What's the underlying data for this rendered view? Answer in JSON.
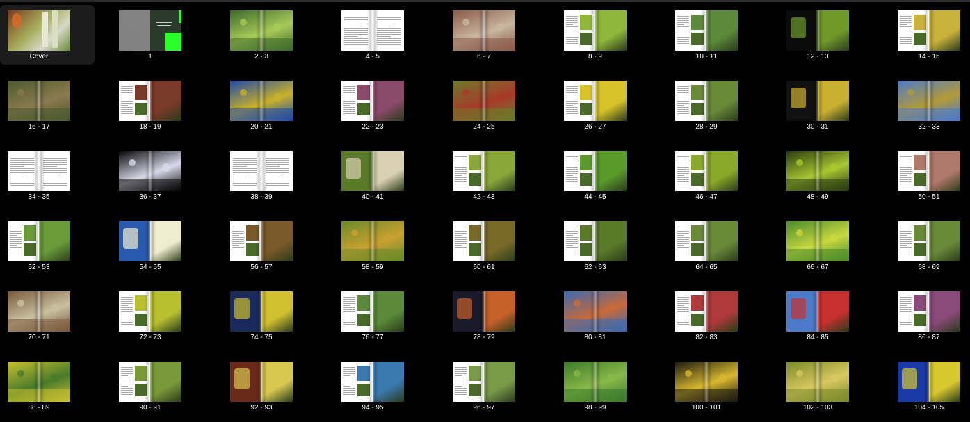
{
  "thumbnails": [
    {
      "label": "Cover",
      "style": "cover"
    },
    {
      "label": "1",
      "style": "title"
    },
    {
      "label": "2 - 3",
      "style": "photo",
      "colors": [
        "#3f6b2a",
        "#a7c95a"
      ]
    },
    {
      "label": "4 - 5",
      "style": "text"
    },
    {
      "label": "6 - 7",
      "style": "photo",
      "colors": [
        "#8a5a4a",
        "#c8b6a0"
      ]
    },
    {
      "label": "8 - 9",
      "style": "mixed",
      "colors": [
        "#ffffff",
        "#8fb83a"
      ]
    },
    {
      "label": "10 - 11",
      "style": "mixed",
      "colors": [
        "#ffffff",
        "#5d8a3a"
      ]
    },
    {
      "label": "12 - 13",
      "style": "mixed",
      "colors": [
        "#0b0b0b",
        "#6f9a2a"
      ]
    },
    {
      "label": "14 - 15",
      "style": "mixed",
      "colors": [
        "#ffffff",
        "#c9b23a"
      ]
    },
    {
      "label": "16 - 17",
      "style": "photo",
      "colors": [
        "#4b5a2e",
        "#8a7a4e"
      ]
    },
    {
      "label": "18 - 19",
      "style": "mixed",
      "colors": [
        "#ffffff",
        "#7a3a2a"
      ]
    },
    {
      "label": "20 - 21",
      "style": "photo",
      "colors": [
        "#1f4aa8",
        "#c7b12a"
      ]
    },
    {
      "label": "22 - 23",
      "style": "mixed",
      "colors": [
        "#ffffff",
        "#8a4a6a"
      ]
    },
    {
      "label": "24 - 25",
      "style": "photo",
      "colors": [
        "#6b7a2a",
        "#a83a2a"
      ]
    },
    {
      "label": "26 - 27",
      "style": "mixed",
      "colors": [
        "#ffffff",
        "#d6c22a"
      ]
    },
    {
      "label": "28 - 29",
      "style": "mixed",
      "colors": [
        "#ffffff",
        "#6a8a3a"
      ]
    },
    {
      "label": "30 - 31",
      "style": "mixed",
      "colors": [
        "#111111",
        "#c9b030"
      ]
    },
    {
      "label": "32 - 33",
      "style": "photo",
      "colors": [
        "#4f7ac8",
        "#b09a3a"
      ]
    },
    {
      "label": "34 - 35",
      "style": "text"
    },
    {
      "label": "36 - 37",
      "style": "photo",
      "colors": [
        "#050505",
        "#d8d8e8"
      ]
    },
    {
      "label": "38 - 39",
      "style": "text"
    },
    {
      "label": "40 - 41",
      "style": "mixed",
      "colors": [
        "#5a7a2a",
        "#d8d0b0"
      ]
    },
    {
      "label": "42 - 43",
      "style": "mixed",
      "colors": [
        "#ffffff",
        "#8aa83a"
      ]
    },
    {
      "label": "44 - 45",
      "style": "mixed",
      "colors": [
        "#ffffff",
        "#5a9a2a"
      ]
    },
    {
      "label": "46 - 47",
      "style": "mixed",
      "colors": [
        "#ffffff",
        "#8aa82a"
      ]
    },
    {
      "label": "48 - 49",
      "style": "photo",
      "colors": [
        "#2a3a10",
        "#a8c830"
      ]
    },
    {
      "label": "50 - 51",
      "style": "mixed",
      "colors": [
        "#ffffff",
        "#b07a6a"
      ]
    },
    {
      "label": "52 - 53",
      "style": "mixed",
      "colors": [
        "#ffffff",
        "#6a9a3a"
      ]
    },
    {
      "label": "54 - 55",
      "style": "mixed",
      "colors": [
        "#2a5ab0",
        "#f0ecd0"
      ]
    },
    {
      "label": "56 - 57",
      "style": "mixed",
      "colors": [
        "#ffffff",
        "#7a5a2a"
      ]
    },
    {
      "label": "58 - 59",
      "style": "photo",
      "colors": [
        "#6a8a2a",
        "#c8a030"
      ]
    },
    {
      "label": "60 - 61",
      "style": "mixed",
      "colors": [
        "#ffffff",
        "#7a6a2a"
      ]
    },
    {
      "label": "62 - 63",
      "style": "mixed",
      "colors": [
        "#ffffff",
        "#5a7a2a"
      ]
    },
    {
      "label": "64 - 65",
      "style": "mixed",
      "colors": [
        "#ffffff",
        "#6a8a3a"
      ]
    },
    {
      "label": "66 - 67",
      "style": "photo",
      "colors": [
        "#4a8a2a",
        "#c8d840"
      ]
    },
    {
      "label": "68 - 69",
      "style": "mixed",
      "colors": [
        "#ffffff",
        "#6a8a3a"
      ]
    },
    {
      "label": "70 - 71",
      "style": "photo",
      "colors": [
        "#7a5a3a",
        "#c8c0a0"
      ]
    },
    {
      "label": "72 - 73",
      "style": "mixed",
      "colors": [
        "#ffffff",
        "#b8c030"
      ]
    },
    {
      "label": "74 - 75",
      "style": "mixed",
      "colors": [
        "#1a2a5a",
        "#d0c030"
      ]
    },
    {
      "label": "76 - 77",
      "style": "mixed",
      "colors": [
        "#ffffff",
        "#5a8a3a"
      ]
    },
    {
      "label": "78 - 79",
      "style": "mixed",
      "colors": [
        "#1a1a2a",
        "#c8602a"
      ]
    },
    {
      "label": "80 - 81",
      "style": "photo",
      "colors": [
        "#3a6ab0",
        "#c86a3a"
      ]
    },
    {
      "label": "82 - 83",
      "style": "mixed",
      "colors": [
        "#ffffff",
        "#b03a3a"
      ]
    },
    {
      "label": "84 - 85",
      "style": "mixed",
      "colors": [
        "#4a7ac8",
        "#c83030"
      ]
    },
    {
      "label": "86 - 87",
      "style": "mixed",
      "colors": [
        "#ffffff",
        "#8a4a7a"
      ]
    },
    {
      "label": "88 - 89",
      "style": "photo",
      "colors": [
        "#c8c030",
        "#4a7a2a"
      ]
    },
    {
      "label": "90 - 91",
      "style": "mixed",
      "colors": [
        "#ffffff",
        "#7a9a3a"
      ]
    },
    {
      "label": "92 - 93",
      "style": "mixed",
      "colors": [
        "#6a2a1a",
        "#d8c850"
      ]
    },
    {
      "label": "94 - 95",
      "style": "mixed",
      "colors": [
        "#ffffff",
        "#3a7ab0"
      ]
    },
    {
      "label": "96 - 97",
      "style": "mixed",
      "colors": [
        "#ffffff",
        "#7a9a4a"
      ]
    },
    {
      "label": "98 - 99",
      "style": "photo",
      "colors": [
        "#3a7a2a",
        "#8ab84a"
      ]
    },
    {
      "label": "100 - 101",
      "style": "photo",
      "colors": [
        "#1a1a10",
        "#d8b830"
      ]
    },
    {
      "label": "102 - 103",
      "style": "photo",
      "colors": [
        "#7a8a2a",
        "#d8c860"
      ]
    },
    {
      "label": "104 - 105",
      "style": "mixed",
      "colors": [
        "#1a3aa8",
        "#d8c830"
      ]
    }
  ],
  "selected_index": 0
}
